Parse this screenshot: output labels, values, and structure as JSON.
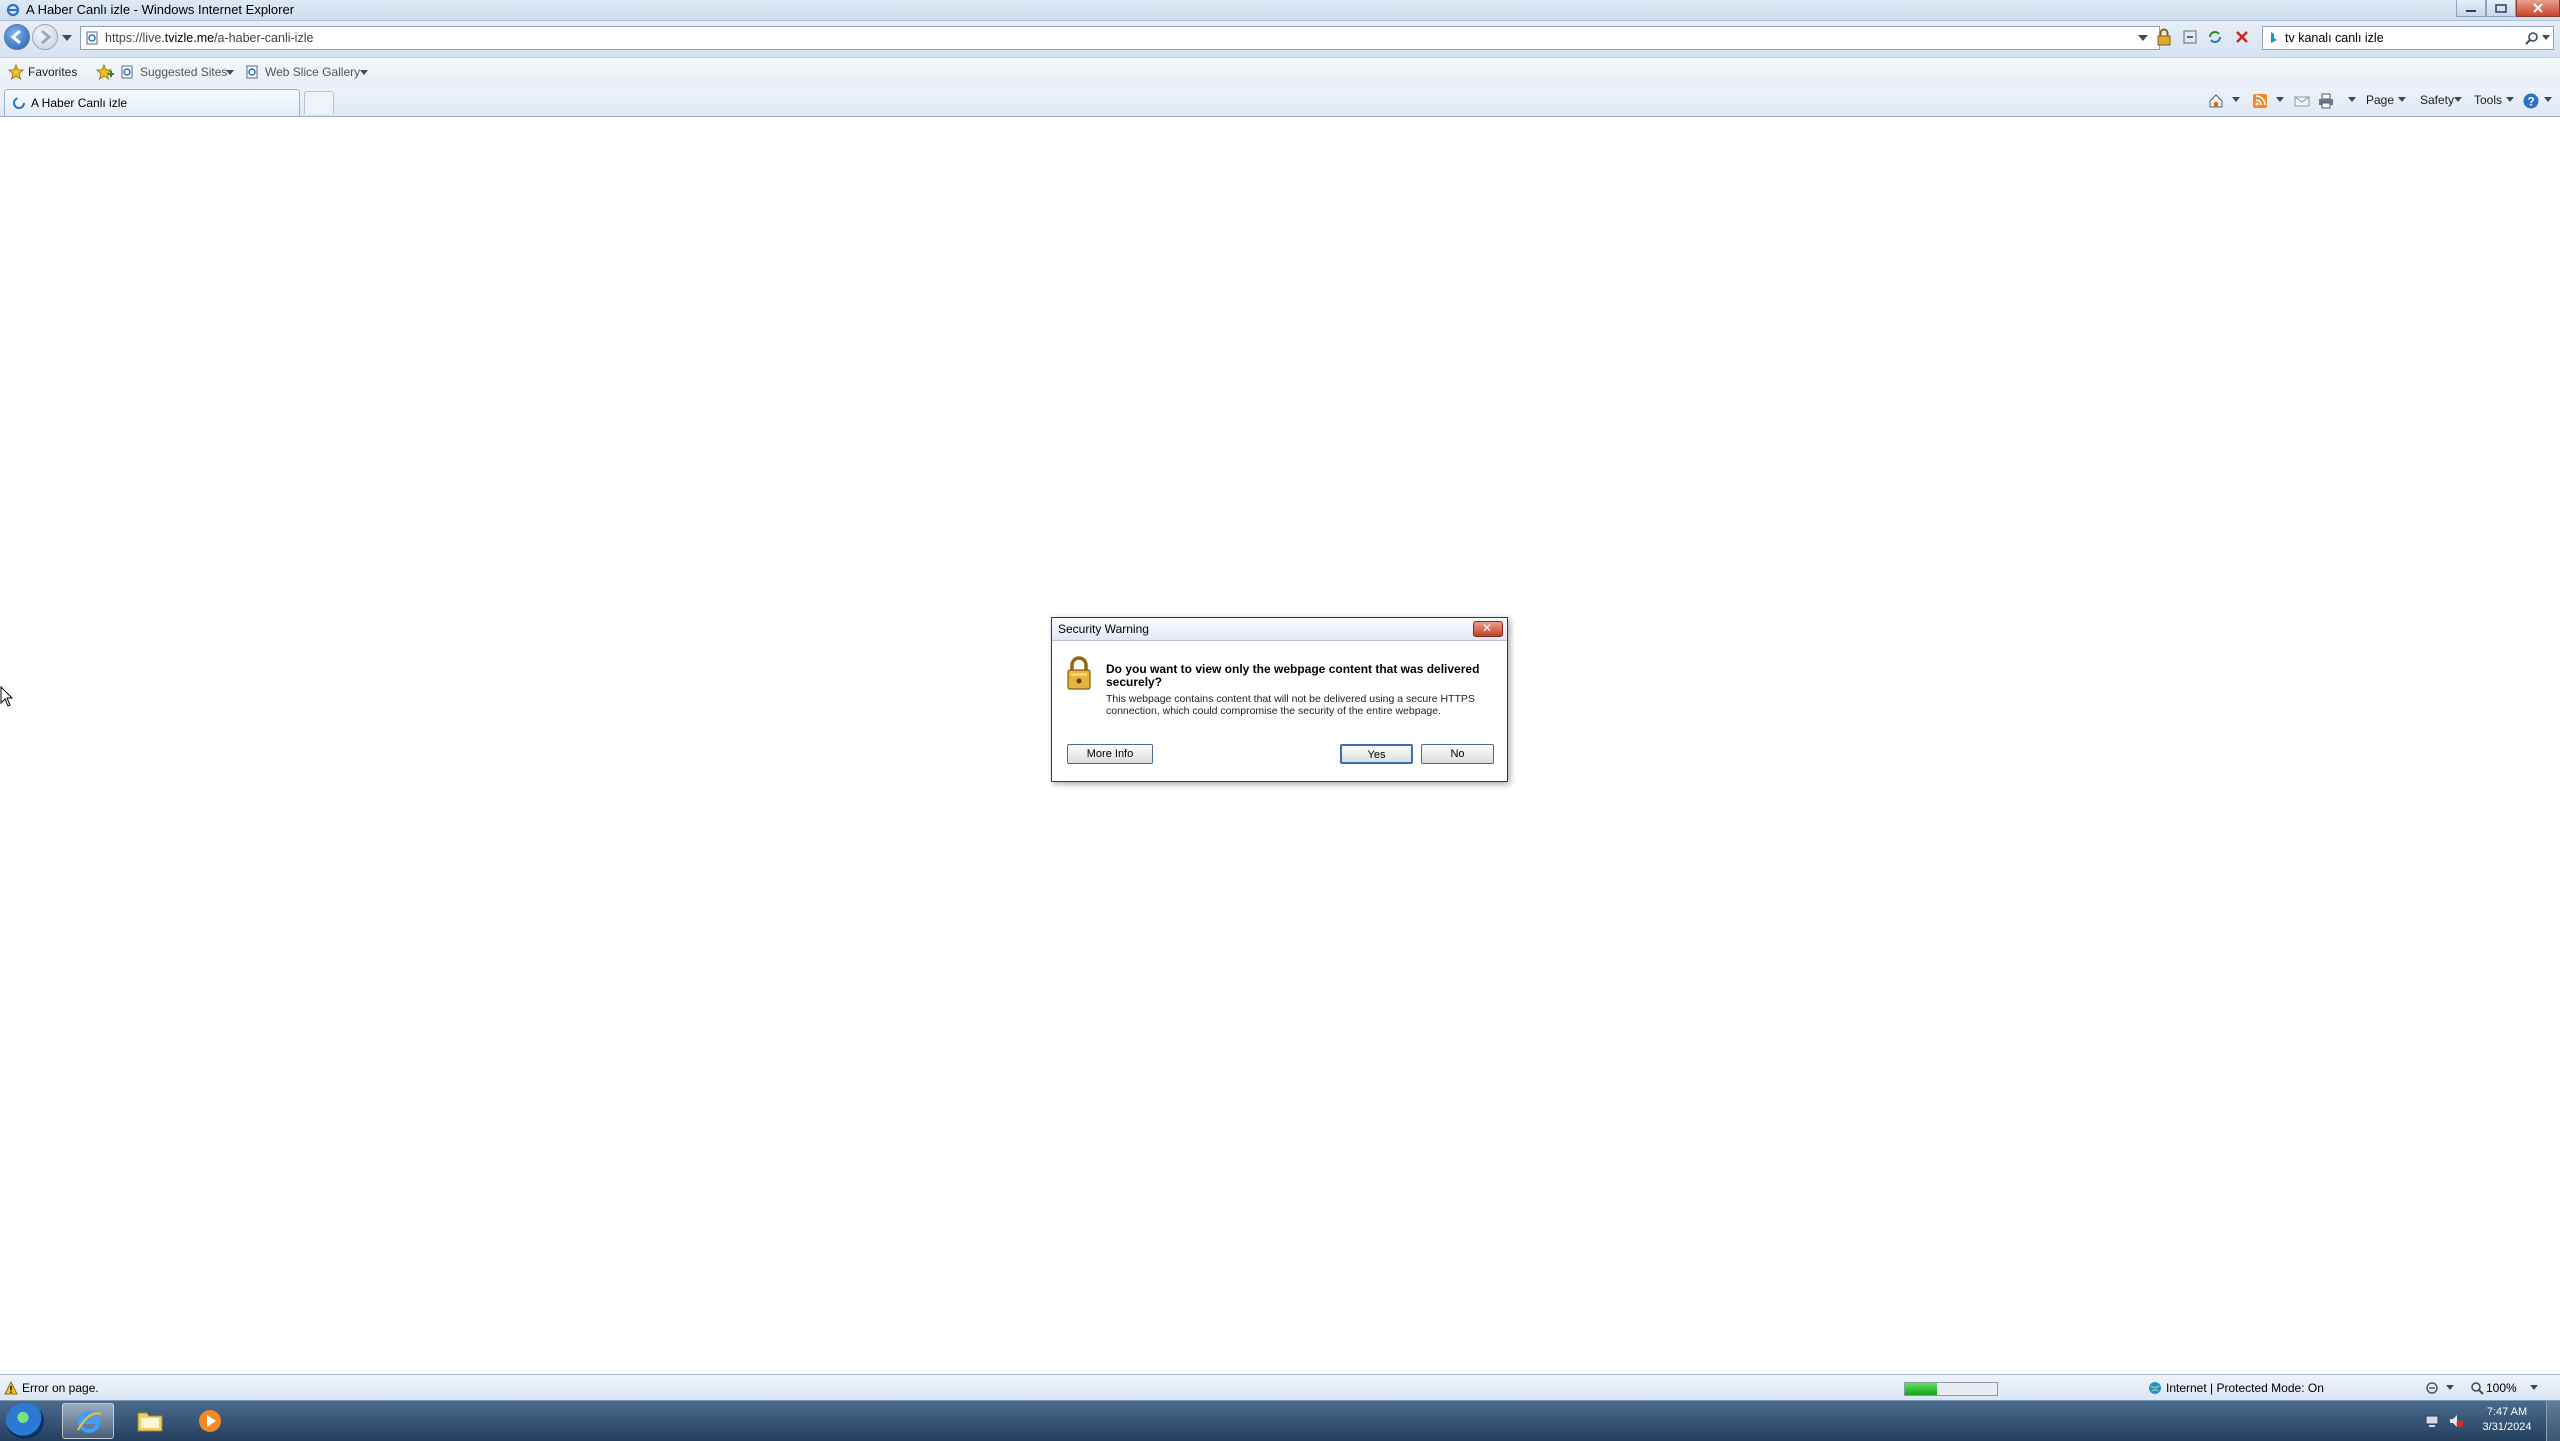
{
  "window": {
    "title": "A Haber Canlı izle - Windows Internet Explorer"
  },
  "address_bar": {
    "url_prefix": "https://live.",
    "url_domain": "tvizle.me",
    "url_path": "/a-haber-canli-izle"
  },
  "search": {
    "query": "tv kanalı canlı izle"
  },
  "favorites_bar": {
    "favorites_label": "Favorites",
    "suggested_sites": "Suggested Sites",
    "web_slice_gallery": "Web Slice Gallery"
  },
  "tab": {
    "title": "A Haber Canlı izle"
  },
  "command_bar": {
    "page": "Page",
    "safety": "Safety",
    "tools": "Tools"
  },
  "dialog": {
    "title": "Security Warning",
    "headline": "Do you want to view only the webpage content that was delivered securely?",
    "text": "This webpage contains content that will not be delivered using a secure HTTPS connection, which could compromise the security of the entire webpage.",
    "more_info": "More Info",
    "yes": "Yes",
    "no": "No"
  },
  "status_bar": {
    "message": "Error on page.",
    "zone": "Internet | Protected Mode: On",
    "zoom": "100%",
    "progress": 0.35
  },
  "taskbar": {
    "time": "7:47 AM",
    "date": "3/31/2024"
  },
  "colors": {
    "chrome": "#dbe5f2",
    "dialog_border": "#1b3f6e",
    "close_red": "#c9452c"
  }
}
